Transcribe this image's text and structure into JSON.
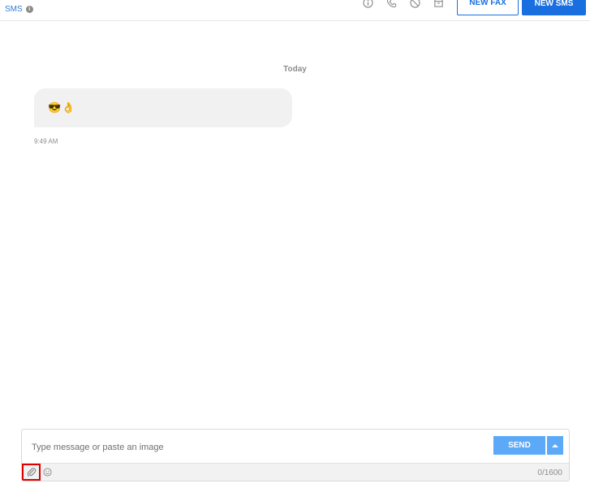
{
  "header": {
    "title": "SMS",
    "title_info_icon": "info-icon",
    "actions": [
      {
        "name": "info-icon"
      },
      {
        "name": "phone-icon"
      },
      {
        "name": "block-icon"
      },
      {
        "name": "archive-icon"
      }
    ],
    "new_fax_label": "NEW FAX",
    "new_sms_label": "NEW SMS"
  },
  "conversation": {
    "day_label": "Today",
    "messages": [
      {
        "text": "😎👌",
        "time": "9:49 AM"
      }
    ]
  },
  "composer": {
    "placeholder": "Type message or paste an image",
    "value": "",
    "send_label": "SEND",
    "attach_icon": "paperclip-icon",
    "emoji_icon": "smiley-icon",
    "char_count": "0/1600"
  },
  "colors": {
    "accent": "#1a6fe0",
    "send_button": "#5ca9f8",
    "highlight_box": "#e00000"
  }
}
